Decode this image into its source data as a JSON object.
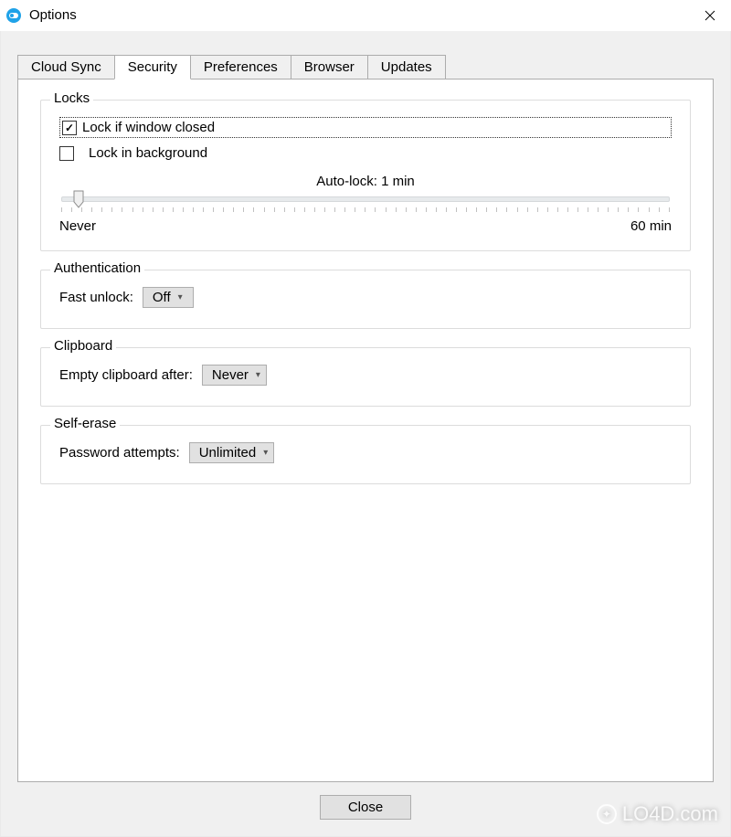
{
  "window": {
    "title": "Options"
  },
  "tabs": [
    {
      "label": "Cloud Sync"
    },
    {
      "label": "Security"
    },
    {
      "label": "Preferences"
    },
    {
      "label": "Browser"
    },
    {
      "label": "Updates"
    }
  ],
  "active_tab": 1,
  "locks": {
    "legend": "Locks",
    "lock_if_window_closed": {
      "label": "Lock if window closed",
      "checked": true
    },
    "lock_in_background": {
      "label": "Lock in background",
      "checked": false
    },
    "auto_lock_label": "Auto-lock: 1 min",
    "slider": {
      "min_label": "Never",
      "max_label": "60 min",
      "value": 1,
      "max": 60
    }
  },
  "authentication": {
    "legend": "Authentication",
    "fast_unlock_label": "Fast unlock:",
    "fast_unlock_value": "Off"
  },
  "clipboard": {
    "legend": "Clipboard",
    "empty_after_label": "Empty clipboard after:",
    "empty_after_value": "Never"
  },
  "self_erase": {
    "legend": "Self-erase",
    "password_attempts_label": "Password attempts:",
    "password_attempts_value": "Unlimited"
  },
  "buttons": {
    "close": "Close"
  },
  "watermark": "LO4D.com"
}
